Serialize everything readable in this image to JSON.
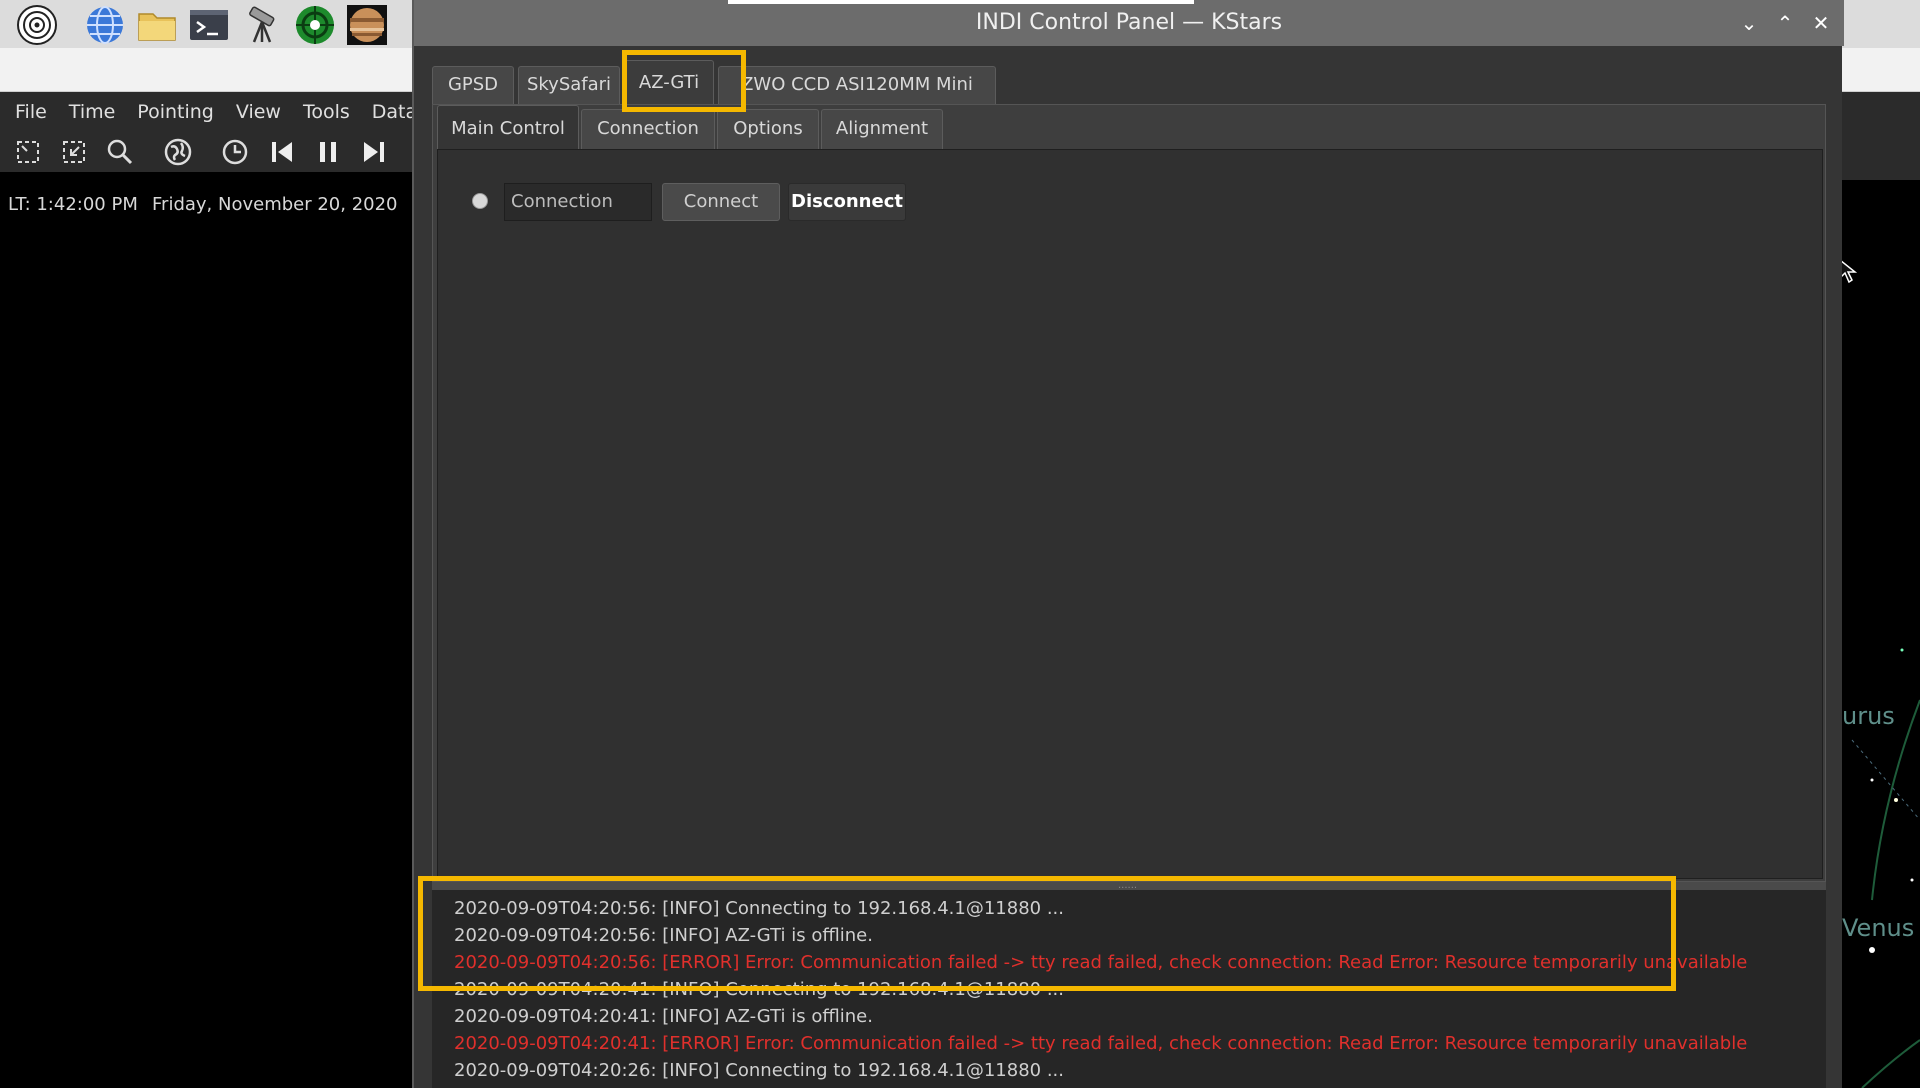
{
  "colors": {
    "highlight": "#f5b800",
    "error_text": "#e0302c",
    "info_text": "#cfcfcf"
  },
  "taskbar": {
    "icons": [
      "raspberry-menu-icon",
      "web-browser-icon",
      "file-manager-icon",
      "terminal-icon",
      "telescope-icon",
      "phd2-icon",
      "planet-icon"
    ]
  },
  "kstars": {
    "menu": [
      "File",
      "Time",
      "Pointing",
      "View",
      "Tools",
      "Data"
    ],
    "toolbar_icons": [
      "zoom-fit-icon",
      "zoom-select-icon",
      "search-icon",
      "globe-icon",
      "clock-icon",
      "step-back-icon",
      "pause-icon",
      "step-forward-icon"
    ],
    "status": {
      "local_time": "LT: 1:42:00 PM",
      "date": "Friday, November 20, 2020"
    },
    "sky_labels": [
      "urus",
      "Venus"
    ]
  },
  "indi": {
    "window_title": "INDI Control Panel — KStars",
    "window_buttons": {
      "minimize": "⌄",
      "maximize": "⌃",
      "close": "✕"
    },
    "device_tabs": [
      "GPSD",
      "SkySafari",
      "AZ-GTi",
      "ZWO CCD ASI120MM Mini"
    ],
    "active_device": "AZ-GTi",
    "property_tabs": [
      "Main Control",
      "Connection",
      "Options",
      "Alignment"
    ],
    "active_property_tab": "Main Control",
    "connection": {
      "label": "Connection",
      "connect": "Connect",
      "disconnect": "Disconnect"
    },
    "splitter_grip": "......",
    "log": [
      {
        "text": "2020-09-09T04:20:56: [INFO] Connecting to 192.168.4.1@11880 ...",
        "level": "info"
      },
      {
        "text": "2020-09-09T04:20:56: [INFO] AZ-GTi is offline.",
        "level": "info"
      },
      {
        "text": "2020-09-09T04:20:56: [ERROR] Error: Communication failed -> tty read failed, check connection: Read Error: Resource temporarily unavailable",
        "level": "error"
      },
      {
        "text": "2020-09-09T04:20:41: [INFO] Connecting to 192.168.4.1@11880 ...",
        "level": "info"
      },
      {
        "text": "2020-09-09T04:20:41: [INFO] AZ-GTi is offline.",
        "level": "info"
      },
      {
        "text": "2020-09-09T04:20:41: [ERROR] Error: Communication failed -> tty read failed, check connection: Read Error: Resource temporarily unavailable",
        "level": "error"
      },
      {
        "text": "2020-09-09T04:20:26: [INFO] Connecting to 192.168.4.1@11880 ...",
        "level": "info"
      }
    ]
  }
}
